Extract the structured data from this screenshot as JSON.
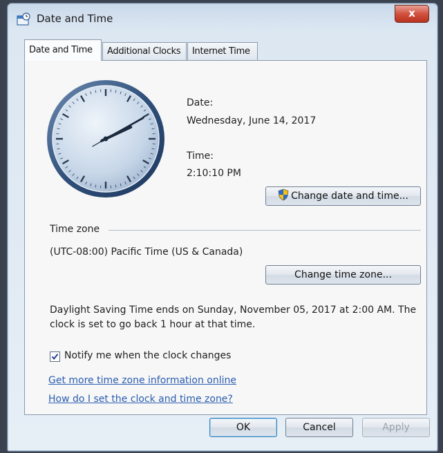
{
  "window": {
    "title": "Date and Time",
    "close_label": "x"
  },
  "tabs": [
    {
      "label": "Date and Time",
      "active": true
    },
    {
      "label": "Additional Clocks",
      "active": false
    },
    {
      "label": "Internet Time",
      "active": false
    }
  ],
  "clock": {
    "hour": 2,
    "minute": 10,
    "second": 10
  },
  "date": {
    "label": "Date:",
    "value": "Wednesday, June 14, 2017"
  },
  "time": {
    "label": "Time:",
    "value": "2:10:10 PM"
  },
  "buttons": {
    "change_datetime": "Change date and time...",
    "change_timezone": "Change time zone...",
    "ok": "OK",
    "cancel": "Cancel",
    "apply": "Apply"
  },
  "timezone": {
    "section_label": "Time zone",
    "value": "(UTC-08:00) Pacific Time (US & Canada)"
  },
  "dst": {
    "line1": "Daylight Saving Time ends on Sunday, November 05, 2017 at 2:00 AM. The",
    "line2": "clock is set to go back 1 hour at that time."
  },
  "notify": {
    "label": "Notify me when the clock changes",
    "checked": true
  },
  "links": {
    "more_info": "Get more time zone information online",
    "how_to": "How do I set the clock and time zone?"
  },
  "icons": {
    "app": "date-time-icon",
    "shield": "uac-shield-icon",
    "close": "close-icon"
  },
  "colors": {
    "link": "#2a5db0",
    "close_button": "#d2513f"
  }
}
